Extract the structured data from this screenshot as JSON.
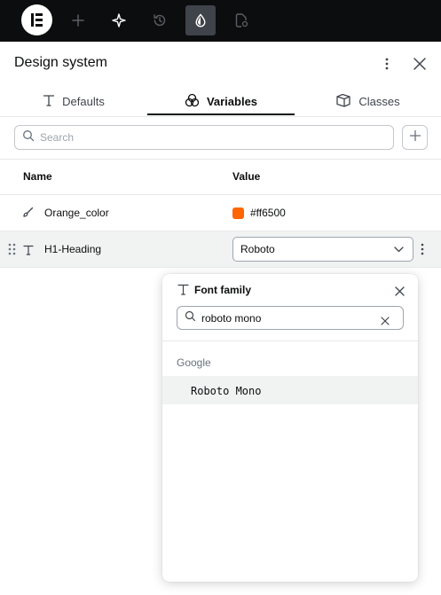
{
  "toolbar": {
    "logo_icon": "elementor-logo-icon",
    "items": [
      {
        "icon": "add-icon"
      },
      {
        "icon": "ai-sparkle-icon"
      },
      {
        "icon": "history-icon"
      },
      {
        "icon": "global-styles-drop-icon",
        "active": true
      },
      {
        "icon": "page-settings-icon"
      }
    ]
  },
  "panel": {
    "title": "Design system"
  },
  "tabs": [
    {
      "label": "Defaults",
      "icon": "typography-icon"
    },
    {
      "label": "Variables",
      "icon": "variables-circles-icon",
      "active": true
    },
    {
      "label": "Classes",
      "icon": "classes-cube-icon"
    }
  ],
  "search": {
    "placeholder": "Search"
  },
  "table": {
    "headers": {
      "name": "Name",
      "value": "Value"
    },
    "rows": [
      {
        "name": "Orange_color",
        "type_icon": "brush-icon",
        "value": "#ff6500",
        "swatch_color": "#ff6500"
      },
      {
        "name": "H1-Heading",
        "type_icon": "typography-icon",
        "value": "Roboto"
      }
    ]
  },
  "font_popover": {
    "title": "Font family",
    "search_value": "roboto mono",
    "group": "Google",
    "results": [
      "Roboto Mono"
    ]
  },
  "colors": {
    "toolbar_bg": "#0c0d0e",
    "accent_orange": "#ff6500",
    "row_hover": "#f1f3f3"
  }
}
